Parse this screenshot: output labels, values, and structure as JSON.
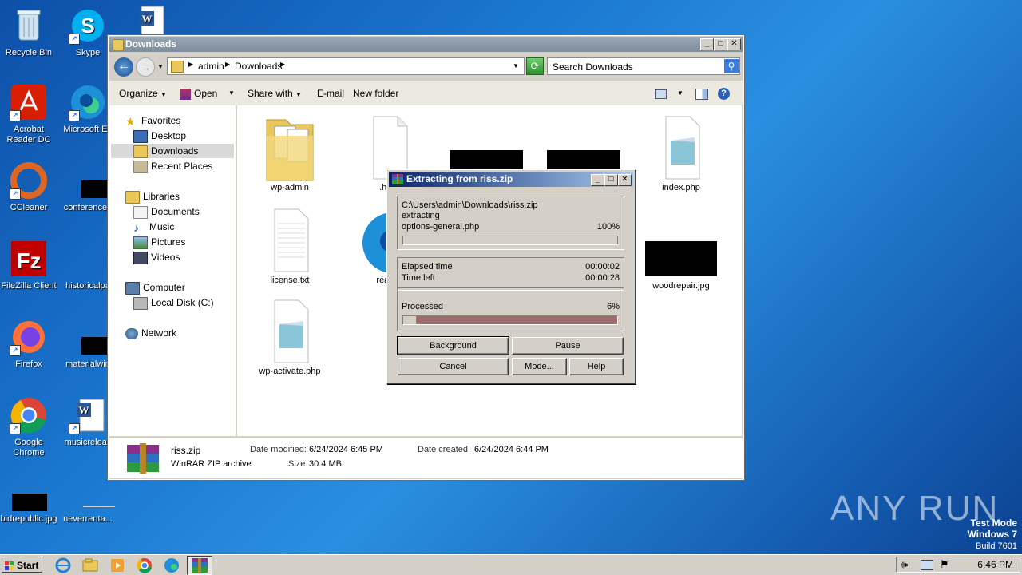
{
  "desktop": {
    "icons": [
      {
        "label": "Recycle Bin"
      },
      {
        "label": "Skype"
      },
      {
        "label": "Acrobat Reader DC"
      },
      {
        "label": "Microsoft Ed"
      },
      {
        "label": "CCleaner"
      },
      {
        "label": "conferenced"
      },
      {
        "label": "FileZilla Client"
      },
      {
        "label": "historicalpa"
      },
      {
        "label": "Firefox"
      },
      {
        "label": "materialwin"
      },
      {
        "label": "Google Chrome"
      },
      {
        "label": "musicreleas"
      },
      {
        "label": "bidrepublic.jpg"
      },
      {
        "label": "neverrenta..."
      }
    ]
  },
  "explorer": {
    "title": "Downloads",
    "breadcrumb": [
      "admin",
      "Downloads"
    ],
    "search_placeholder": "Search Downloads",
    "toolbar": {
      "organize": "Organize",
      "open": "Open",
      "share_with": "Share with",
      "email": "E-mail",
      "new_folder": "New folder"
    },
    "nav": {
      "favorites": "Favorites",
      "desktop": "Desktop",
      "downloads": "Downloads",
      "recent": "Recent Places",
      "libraries": "Libraries",
      "documents": "Documents",
      "music": "Music",
      "pictures": "Pictures",
      "videos": "Videos",
      "computer": "Computer",
      "local_disk": "Local Disk (C:)",
      "network": "Network"
    },
    "files": [
      {
        "name": "wp-admin"
      },
      {
        "name": ".htac"
      },
      {
        "name": "index.php"
      },
      {
        "name": "license.txt"
      },
      {
        "name": "readm"
      },
      {
        "name": "woodrepair.jpg"
      },
      {
        "name": "wp-activate.php"
      }
    ],
    "status": {
      "filename": "riss.zip",
      "filetype": "WinRAR ZIP archive",
      "modified_label": "Date modified:",
      "modified": "6/24/2024 6:45 PM",
      "created_label": "Date created:",
      "created": "6/24/2024 6:44 PM",
      "size_label": "Size:",
      "size": "30.4 MB"
    }
  },
  "winrar": {
    "title": "Extracting from riss.zip",
    "path": "C:\\Users\\admin\\Downloads\\riss.zip",
    "action": "extracting",
    "current_file": "options-general.php",
    "file_percent_text": "100%",
    "file_progress": 1.0,
    "elapsed_label": "Elapsed time",
    "elapsed": "00:00:02",
    "left_label": "Time left",
    "left": "00:00:28",
    "processed_label": "Processed",
    "processed_text": "6%",
    "processed_progress": 0.06,
    "buttons": {
      "background": "Background",
      "pause": "Pause",
      "cancel": "Cancel",
      "mode": "Mode...",
      "help": "Help"
    }
  },
  "taskbar": {
    "start": "Start",
    "time": "6:46 PM"
  },
  "watermark": {
    "brand": "ANY RUN",
    "line1": "Test Mode",
    "line2": "Windows 7",
    "line3": "Build 7601"
  }
}
